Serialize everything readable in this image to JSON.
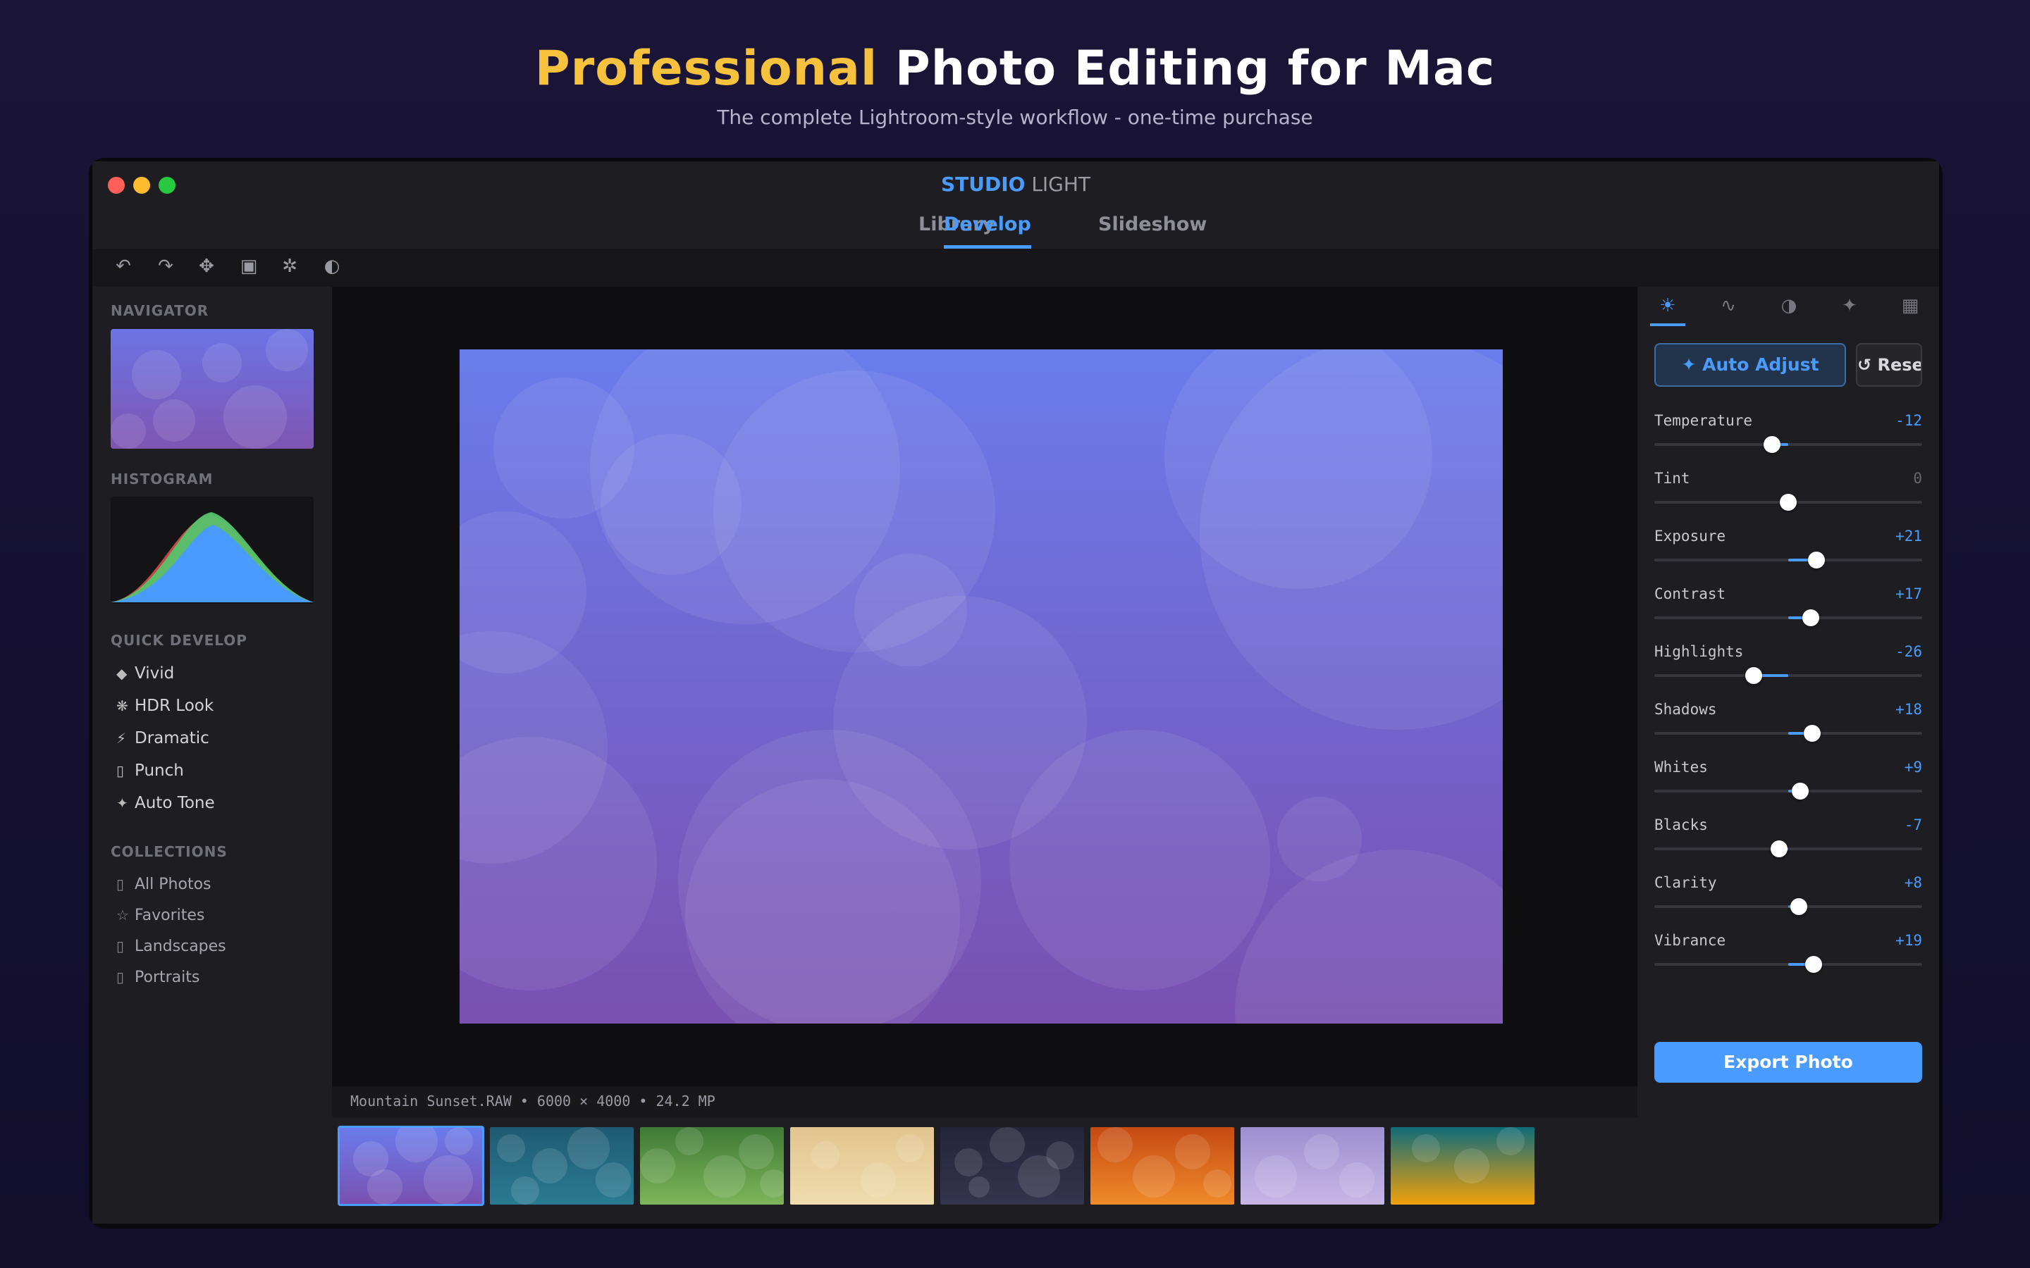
{
  "hero": {
    "title_accent": "Professional",
    "title_rest": " Photo Editing for Mac",
    "subtitle": "The complete Lightroom-style workflow - one-time purchase"
  },
  "app": {
    "name_bold": "STUDIO",
    "name_light": " LIGHT"
  },
  "tabs": [
    {
      "label": "Library",
      "active": false
    },
    {
      "label": "Develop",
      "active": true
    },
    {
      "label": "Slideshow",
      "active": false
    }
  ],
  "toolbar": {
    "icons": [
      "undo-icon",
      "redo-icon",
      "move-icon",
      "crop-icon",
      "spot-heal-icon",
      "mask-icon"
    ],
    "glyphs": [
      "↶",
      "↷",
      "✥",
      "▣",
      "✲",
      "◐"
    ]
  },
  "left": {
    "navigator_label": "NAVIGATOR",
    "histogram_label": "HISTOGRAM",
    "quick_develop_label": "QUICK DEVELOP",
    "presets": [
      {
        "icon": "diamond-icon",
        "glyph": "◆",
        "label": "Vivid"
      },
      {
        "icon": "snowflake-icon",
        "glyph": "❋",
        "label": "HDR Look"
      },
      {
        "icon": "lightning-icon",
        "glyph": "⚡",
        "label": "Dramatic"
      },
      {
        "icon": "box-icon",
        "glyph": "▯",
        "label": "Punch"
      },
      {
        "icon": "sparkle-icon",
        "glyph": "✦",
        "label": "Auto Tone"
      }
    ],
    "collections_label": "COLLECTIONS",
    "collections": [
      {
        "icon": "box-icon",
        "glyph": "▯",
        "label": "All Photos"
      },
      {
        "icon": "star-icon",
        "glyph": "☆",
        "label": "Favorites"
      },
      {
        "icon": "box-icon",
        "glyph": "▯",
        "label": "Landscapes"
      },
      {
        "icon": "box-icon",
        "glyph": "▯",
        "label": "Portraits"
      }
    ]
  },
  "photo_info": "Mountain Sunset.RAW • 6000 × 4000 • 24.2 MP",
  "filmstrip": [
    {
      "from": "#6a7cec",
      "to": "#7a50b0",
      "selected": true
    },
    {
      "from": "#1f5a72",
      "to": "#2a7b93",
      "selected": false
    },
    {
      "from": "#3f7a35",
      "to": "#7db55a",
      "selected": false
    },
    {
      "from": "#e2c58f",
      "to": "#f0dcae",
      "selected": false
    },
    {
      "from": "#24243a",
      "to": "#34344e",
      "selected": false
    },
    {
      "from": "#c54a12",
      "to": "#f08a2a",
      "selected": false
    },
    {
      "from": "#9d8fd1",
      "to": "#c7b7e6",
      "selected": false
    },
    {
      "from": "#0f6b7a",
      "to": "#f2a10a",
      "selected": false
    }
  ],
  "right": {
    "panel_tabs": [
      {
        "icon": "sun-icon",
        "glyph": "☀",
        "active": true
      },
      {
        "icon": "curve-icon",
        "glyph": "∿",
        "active": false
      },
      {
        "icon": "contrast-icon",
        "glyph": "◑",
        "active": false
      },
      {
        "icon": "effects-icon",
        "glyph": "✦",
        "active": false
      },
      {
        "icon": "grid-icon",
        "glyph": "▦",
        "active": false
      }
    ],
    "auto_adjust": "✦ Auto Adjust",
    "reset": "↺ Reset",
    "adjustments": [
      {
        "name": "Temperature",
        "value": "-12",
        "level": -12
      },
      {
        "name": "Tint",
        "value": "0",
        "level": 0
      },
      {
        "name": "Exposure",
        "value": "+21",
        "level": 21
      },
      {
        "name": "Contrast",
        "value": "+17",
        "level": 17
      },
      {
        "name": "Highlights",
        "value": "-26",
        "level": -26
      },
      {
        "name": "Shadows",
        "value": "+18",
        "level": 18
      },
      {
        "name": "Whites",
        "value": "+9",
        "level": 9
      },
      {
        "name": "Blacks",
        "value": "-7",
        "level": -7
      },
      {
        "name": "Clarity",
        "value": "+8",
        "level": 8
      },
      {
        "name": "Vibrance",
        "value": "+19",
        "level": 19
      }
    ],
    "export": "Export Photo"
  },
  "colors": {
    "accent": "#4a9bff",
    "hero_accent": "#f6c23e"
  }
}
